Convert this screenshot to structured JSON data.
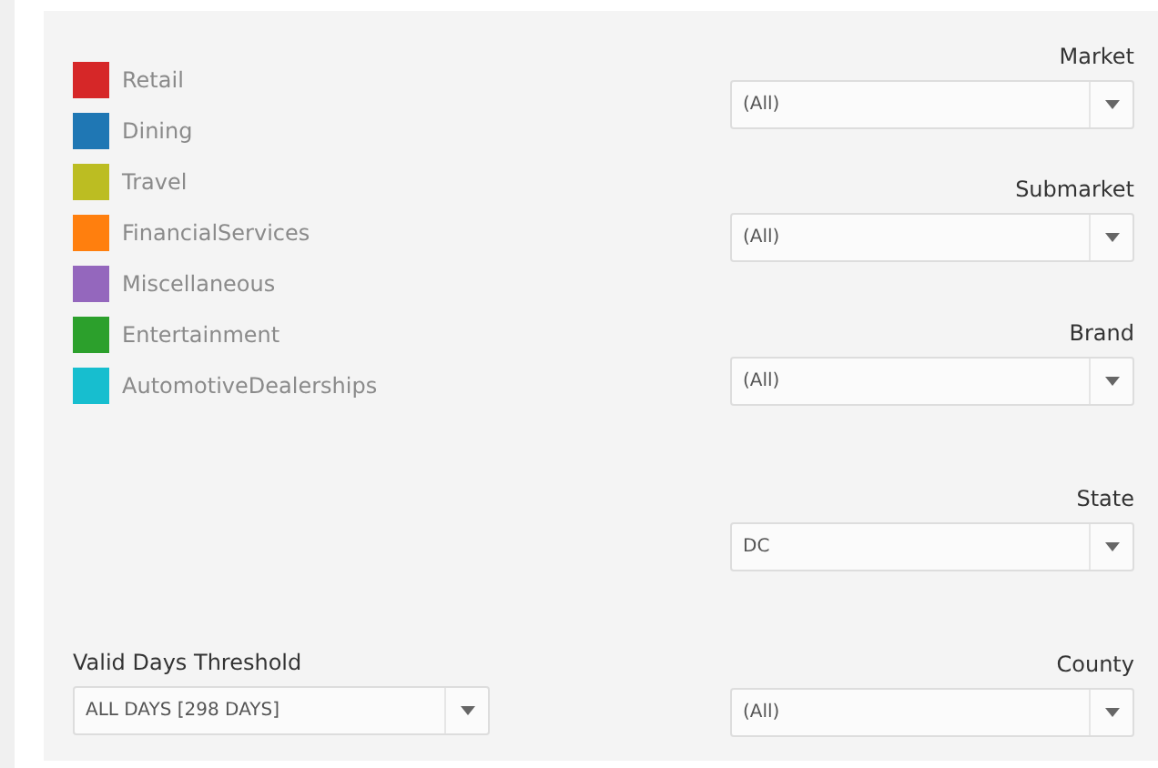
{
  "legend": [
    {
      "label": "Retail",
      "color": "#d62728"
    },
    {
      "label": "Dining",
      "color": "#1f77b4"
    },
    {
      "label": "Travel",
      "color": "#bcbd22"
    },
    {
      "label": "FinancialServices",
      "color": "#ff7f0e"
    },
    {
      "label": "Miscellaneous",
      "color": "#9467bd"
    },
    {
      "label": "Entertainment",
      "color": "#2ca02c"
    },
    {
      "label": "AutomotiveDealerships",
      "color": "#17becf"
    }
  ],
  "threshold": {
    "label": "Valid Days Threshold",
    "value": "ALL DAYS [298 DAYS]"
  },
  "filters": [
    {
      "label": "Market",
      "value": "(All)"
    },
    {
      "label": "Submarket",
      "value": "(All)"
    },
    {
      "label": "Brand",
      "value": "(All)"
    },
    {
      "label": "State",
      "value": "DC"
    },
    {
      "label": "County",
      "value": "(All)"
    }
  ]
}
